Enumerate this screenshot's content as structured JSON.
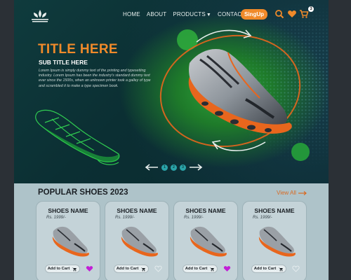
{
  "nav": {
    "items": [
      "HOME",
      "ABOUT",
      "PRODUCTS",
      "CONTACT"
    ],
    "signup_label": "SingUp",
    "cart_count": "3"
  },
  "hero": {
    "title": "TITLE HERE",
    "subtitle": "SUB TITLE HERE",
    "body": "Lorem Ipsum is simply dummy text of the printing and typesetting industry. Lorem Ipsum has been the industry's standard dummy text ever since the 1500s, when an unknown printer took a galley of type and scrambled it to make a type specimen book.",
    "carousel_dots": [
      "1",
      "2",
      "3"
    ]
  },
  "popular": {
    "title": "POPULAR SHOES 2023",
    "view_all": "View All",
    "cards": [
      {
        "name": "SHOES NAME",
        "price": "Rs. 1999/-",
        "add_label": "Add to Cart",
        "liked": true
      },
      {
        "name": "SHOES NAME",
        "price": "Rs. 1999/-",
        "add_label": "Add to Cart",
        "liked": false
      },
      {
        "name": "SHOES NAME",
        "price": "Rs. 1999/-",
        "add_label": "Add to Cart",
        "liked": true
      },
      {
        "name": "SHOES NAME",
        "price": "Rs. 1999/-",
        "add_label": "Add to Cart",
        "liked": false
      }
    ]
  },
  "colors": {
    "accent": "#f08a2a",
    "hero_green": "#2eaa3c",
    "liked_heart": "#c21fd6",
    "section_bg": "#aec3c9"
  },
  "icons": [
    "brand-logo-icon",
    "search-icon",
    "heart-icon",
    "cart-icon",
    "arrow-left-icon",
    "arrow-right-icon",
    "cart-small-icon"
  ]
}
